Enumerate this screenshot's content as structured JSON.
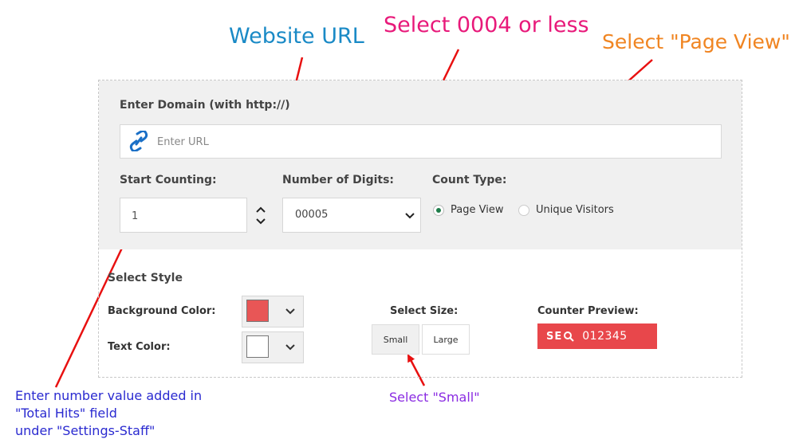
{
  "annotations": {
    "website_url": "Website URL",
    "select_digits": "Select 0004 or less",
    "select_page_view": "Select \"Page View\"",
    "enter_number_line1": "Enter number value added in",
    "enter_number_line2": "\"Total Hits\" field",
    "enter_number_line3": "under \"Settings-Staff\"",
    "select_small": "Select \"Small\""
  },
  "colors": {
    "blue_note": "#1a8ac6",
    "pink_note": "#e8197a",
    "orange_note": "#f08522",
    "navy_note": "#2a2ad0",
    "purple_note": "#8a2be2",
    "arrow": "#e81010",
    "counter_bg": "#e8474b",
    "radio_selected": "#1e7d4a"
  },
  "form": {
    "domain_label": "Enter Domain (with http://)",
    "url_placeholder": "Enter URL",
    "url_icon": "link-icon",
    "start_label": "Start Counting:",
    "start_value": "1",
    "digits_label": "Number of Digits:",
    "digits_value": "00005",
    "count_type_label": "Count Type:",
    "count_types": [
      {
        "label": "Page View",
        "selected": true
      },
      {
        "label": "Unique Visitors",
        "selected": false
      }
    ]
  },
  "style": {
    "title": "Select Style",
    "background_color_label": "Background Color:",
    "background_color_value": "#e85656",
    "text_color_label": "Text Color:",
    "text_color_value": "#ffffff",
    "size_label": "Select Size:",
    "sizes": [
      "Small",
      "Large"
    ],
    "preview_label": "Counter Preview:",
    "preview_logo": "SE",
    "preview_value": "012345"
  }
}
